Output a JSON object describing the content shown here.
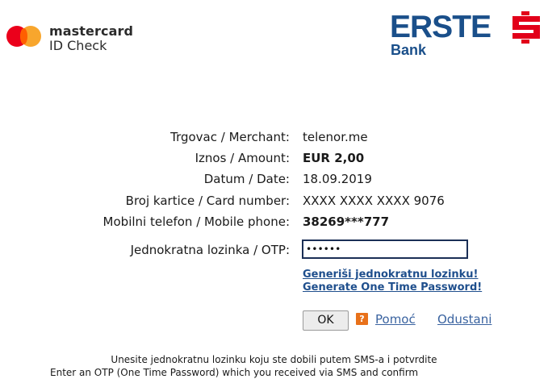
{
  "header": {
    "mastercard_name": "mastercard",
    "mastercard_sub": "ID Check",
    "bank_wordmark": "ERSTE",
    "bank_sub": "Bank",
    "colors": {
      "bank_blue": "#1a4f8a",
      "bank_red": "#e2001a",
      "mc_red": "#eb001b",
      "mc_yellow": "#f79e1b"
    }
  },
  "details": [
    {
      "label": "Trgovac / Merchant:",
      "value": "telenor.me",
      "bold": false
    },
    {
      "label": "Iznos / Amount:",
      "value": "EUR 2,00",
      "bold": true
    },
    {
      "label": "Datum / Date:",
      "value": "18.09.2019",
      "bold": false
    },
    {
      "label": "Broj kartice / Card number:",
      "value": "XXXX XXXX XXXX 9076",
      "bold": false
    },
    {
      "label": "Mobilni telefon / Mobile phone:",
      "value": "38269***777",
      "bold": true
    }
  ],
  "otp": {
    "label": "Jednokratna lozinka / OTP:",
    "value": "••••••"
  },
  "links": {
    "generate_local": "Generiši jednokratnu lozinku!",
    "generate_en": "Generate One Time Password!"
  },
  "actions": {
    "ok_label": "OK",
    "help_icon": "?",
    "help_label": "Pomoć",
    "cancel_label": "Odustani"
  },
  "footer": {
    "line1": "Unesite jednokratnu lozinku koju ste dobili putem SMS-a i potvrdite",
    "line2": "Enter an OTP (One Time Password) which you received via SMS and confirm"
  }
}
